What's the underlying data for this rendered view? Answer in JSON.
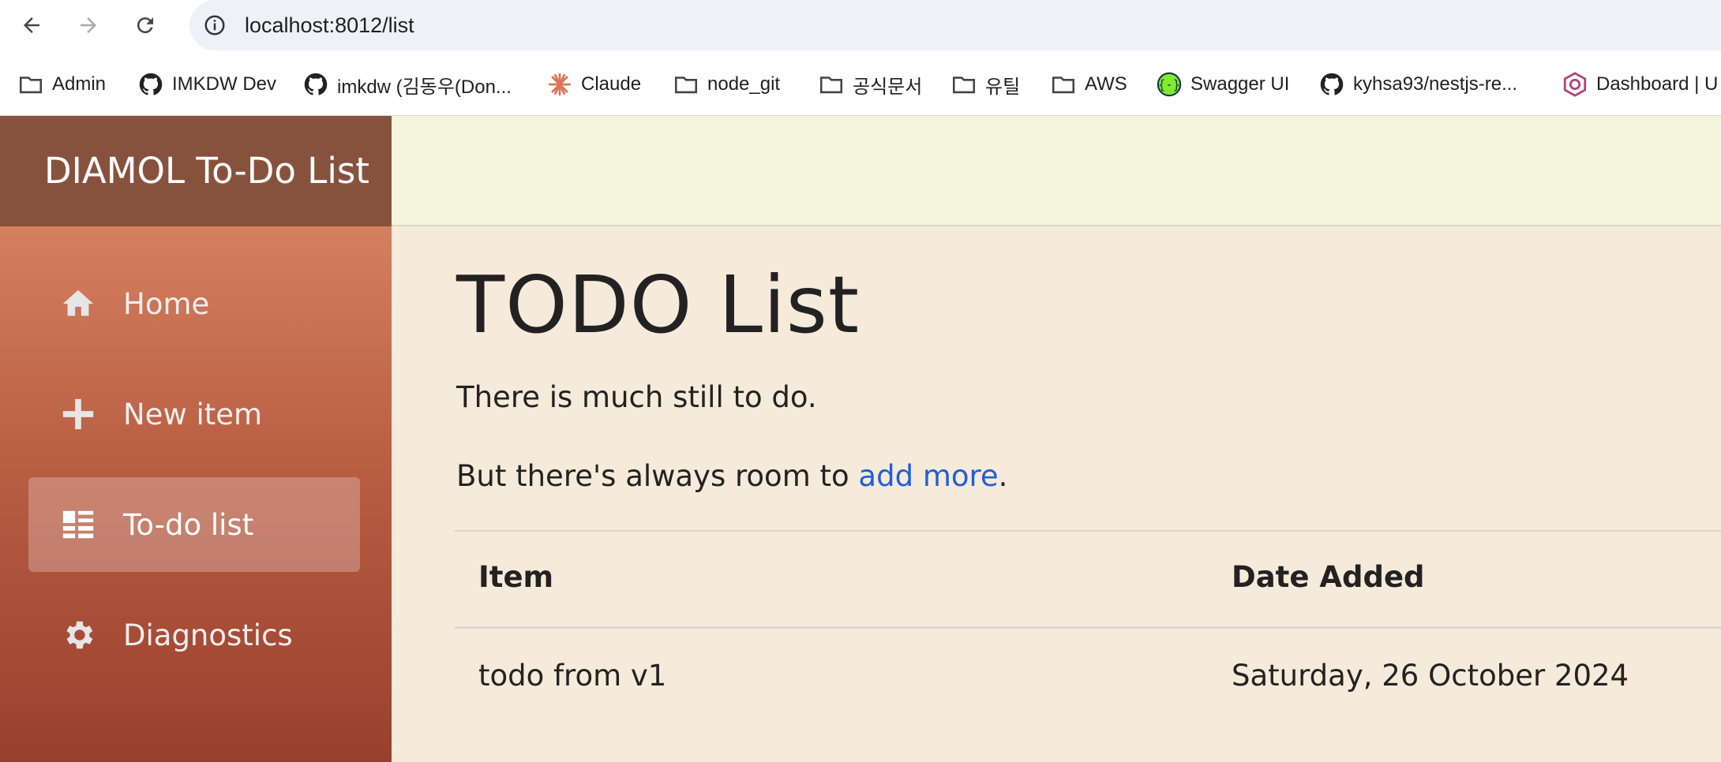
{
  "browser": {
    "url": "localhost:8012/list",
    "bookmarks": [
      {
        "label": "Admin",
        "icon": "folder-icon"
      },
      {
        "label": "IMKDW Dev",
        "icon": "github-icon"
      },
      {
        "label": "imkdw (김동우(Don...",
        "icon": "github-icon"
      },
      {
        "label": "Claude",
        "icon": "claude-icon"
      },
      {
        "label": "node_git",
        "icon": "folder-icon"
      },
      {
        "label": "공식문서",
        "icon": "folder-icon"
      },
      {
        "label": "유틸",
        "icon": "folder-icon"
      },
      {
        "label": "AWS",
        "icon": "folder-icon"
      },
      {
        "label": "Swagger UI",
        "icon": "swagger-icon"
      },
      {
        "label": "kyhsa93/nestjs-re...",
        "icon": "github-icon"
      },
      {
        "label": "Dashboard | U",
        "icon": "dashboard-icon"
      }
    ]
  },
  "app": {
    "brand": "DIAMOL To-Do List",
    "nav": [
      {
        "label": "Home",
        "icon": "home-icon"
      },
      {
        "label": "New item",
        "icon": "plus-icon"
      },
      {
        "label": "To-do list",
        "icon": "list-icon",
        "active": true
      },
      {
        "label": "Diagnostics",
        "icon": "gear-icon"
      }
    ]
  },
  "main": {
    "title": "TODO List",
    "subtitle": "There is much still to do.",
    "more_prefix": "But there's always room to ",
    "more_link": "add more",
    "more_suffix": ".",
    "table": {
      "headers": [
        "Item",
        "Date Added"
      ],
      "rows": [
        {
          "item": "todo from v1",
          "date": "Saturday, 26 October 2024"
        }
      ]
    }
  },
  "colors": {
    "brand_bg": "#87523d",
    "sidebar_top": "#d4805f",
    "sidebar_bottom": "#99402d",
    "header_bg": "#f5f4dc",
    "content_bg": "#f6eada",
    "link": "#1f5fd6"
  }
}
